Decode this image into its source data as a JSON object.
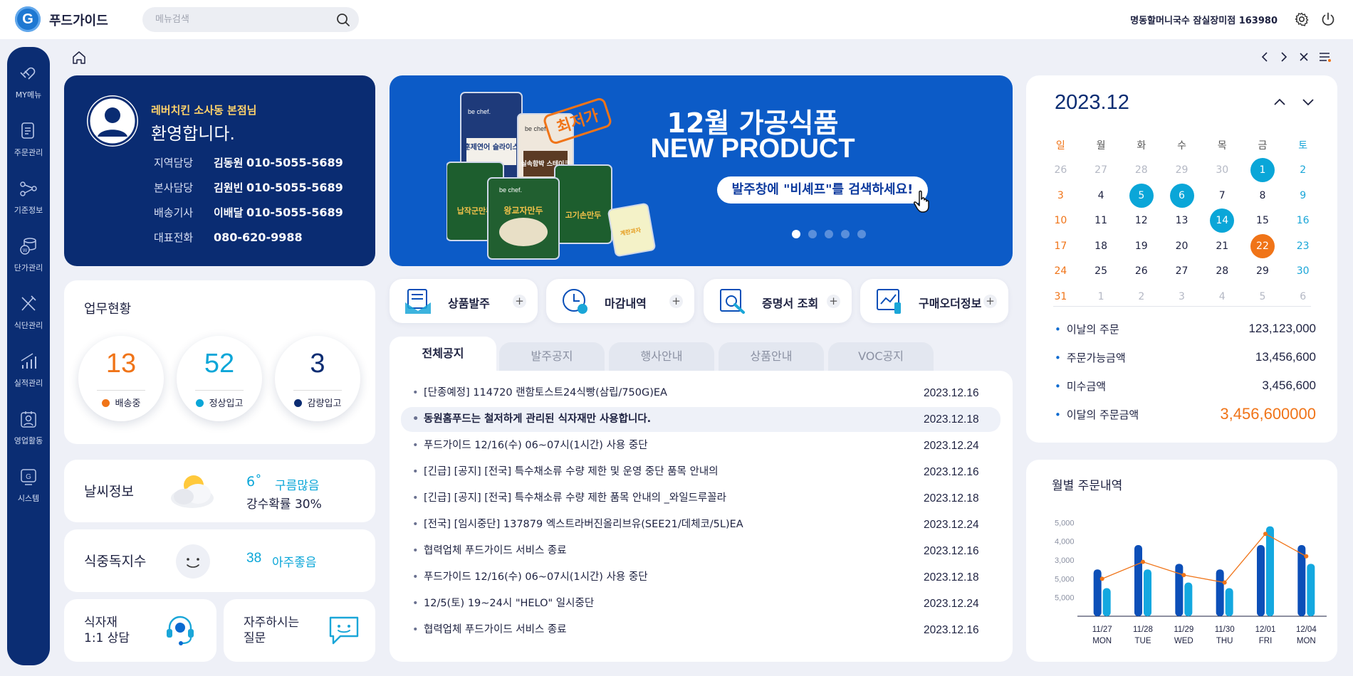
{
  "app": {
    "logo_letter": "G",
    "name": "푸드가이드",
    "search_placeholder": "메뉴검색",
    "store": "명동할머니국수 잠실장미점 163980"
  },
  "sidebar": {
    "items": [
      {
        "label": "MY메뉴",
        "icon": "heart-stack-icon"
      },
      {
        "label": "주문관리",
        "icon": "document-icon"
      },
      {
        "label": "기준정보",
        "icon": "network-icon"
      },
      {
        "label": "단가관리",
        "icon": "coin-stack-icon"
      },
      {
        "label": "식단관리",
        "icon": "cutlery-icon"
      },
      {
        "label": "실적관리",
        "icon": "bar-growth-icon"
      },
      {
        "label": "영업활동",
        "icon": "person-badge-icon"
      },
      {
        "label": "시스템",
        "icon": "g-monitor-icon"
      }
    ]
  },
  "welcome": {
    "name": "레버치킨 소사동 본점님",
    "greeting": "환영합니다.",
    "contacts": [
      {
        "role": "지역담당",
        "name": "김동원",
        "phone": "010-5055-5689"
      },
      {
        "role": "본사담당",
        "name": "김원빈",
        "phone": "010-5055-5689"
      },
      {
        "role": "배송기사",
        "name": "이배달",
        "phone": "010-5055-5689"
      },
      {
        "role": "대표전화",
        "name": "",
        "phone": "080-620-9988"
      }
    ]
  },
  "banner": {
    "title1": "12월 가공식품",
    "title2": "NEW PRODUCT",
    "cta": "발주창에 \"비셰프\"를 검색하세요!",
    "stamp": "최저가",
    "brand": "be chef.",
    "products": [
      "훈제연어 슬라이스",
      "실속함박 스테이크",
      "납작군만두",
      "왕교자만두",
      "고기손만두",
      "계란과자"
    ],
    "slide_count": 5,
    "active_slide": 1
  },
  "status": {
    "title": "업무현황",
    "items": [
      {
        "value": "13",
        "label": "배송중",
        "color": "#f07418"
      },
      {
        "value": "52",
        "label": "정상입고",
        "color": "#0aa6d8"
      },
      {
        "value": "3",
        "label": "감량입고",
        "color": "#0a2c72"
      }
    ]
  },
  "weather": {
    "title": "날씨정보",
    "temp": "6˚",
    "desc": "구름많음",
    "rain": "강수확률 30%"
  },
  "meal_index": {
    "title": "식중독지수",
    "value": "38",
    "desc": "아주좋음"
  },
  "consult": {
    "line1": "식자재",
    "line2": "1:1 상담"
  },
  "faq": {
    "line1": "자주하시는",
    "line2": "질문"
  },
  "quick": [
    {
      "label": "상품발주",
      "icon": "order-envelope-icon"
    },
    {
      "label": "마감내역",
      "icon": "clock-icon"
    },
    {
      "label": "증명서 조회",
      "icon": "magnifier-document-icon"
    },
    {
      "label": "구매오더정보",
      "icon": "chart-board-icon"
    }
  ],
  "notice": {
    "tabs": [
      "전체공지",
      "발주공지",
      "행사안내",
      "상품안내",
      "VOC공지"
    ],
    "active_tab": 0,
    "rows": [
      {
        "title": "[단종예정] 114720 랜함토스트24식빵(삼립/750G)EA",
        "date": "2023.12.16"
      },
      {
        "title": "동원홈푸드는 철저하게 관리된 식자재만 사용합니다.",
        "date": "2023.12.18",
        "highlight": true
      },
      {
        "title": "푸드가이드 12/16(수) 06~07시(1시간) 사용 중단",
        "date": "2023.12.24"
      },
      {
        "title": "[긴급] [공지] [전국] 특수채소류 수량 제한 및 운영 중단 품목 안내의",
        "date": "2023.12.16"
      },
      {
        "title": "[긴급] [공지] [전국] 특수채소류 수량 제한 품목 안내의 _와일드루꼴라",
        "date": "2023.12.18"
      },
      {
        "title": "[전국] [임시중단] 137879 엑스트라버진올리브유(SEE21/데체코/5L)EA",
        "date": "2023.12.24"
      },
      {
        "title": "협력업체 푸드가이드 서비스 종료",
        "date": "2023.12.16"
      },
      {
        "title": "푸드가이드 12/16(수) 06~07시(1시간) 사용 중단",
        "date": "2023.12.18"
      },
      {
        "title": "12/5(토) 19~24시 \"HELO\" 일시중단",
        "date": "2023.12.24"
      },
      {
        "title": "협력업체 푸드가이드 서비스 종료",
        "date": "2023.12.16"
      }
    ]
  },
  "calendar": {
    "title": "2023.12",
    "weekdays": [
      "일",
      "월",
      "화",
      "수",
      "목",
      "금",
      "토"
    ],
    "weeks": [
      [
        {
          "d": "26",
          "o": 1
        },
        {
          "d": "27",
          "o": 1
        },
        {
          "d": "28",
          "o": 1
        },
        {
          "d": "29",
          "o": 1
        },
        {
          "d": "30",
          "o": 1
        },
        {
          "d": "1",
          "m": 1
        },
        {
          "d": "2"
        }
      ],
      [
        {
          "d": "3"
        },
        {
          "d": "4"
        },
        {
          "d": "5",
          "m": 1
        },
        {
          "d": "6",
          "m": 1
        },
        {
          "d": "7"
        },
        {
          "d": "8"
        },
        {
          "d": "9"
        }
      ],
      [
        {
          "d": "10"
        },
        {
          "d": "11"
        },
        {
          "d": "12"
        },
        {
          "d": "13"
        },
        {
          "d": "14",
          "m": 1
        },
        {
          "d": "15"
        },
        {
          "d": "16"
        }
      ],
      [
        {
          "d": "17"
        },
        {
          "d": "18"
        },
        {
          "d": "19"
        },
        {
          "d": "20"
        },
        {
          "d": "21"
        },
        {
          "d": "22",
          "t": 1
        },
        {
          "d": "23"
        }
      ],
      [
        {
          "d": "24"
        },
        {
          "d": "25"
        },
        {
          "d": "26"
        },
        {
          "d": "27"
        },
        {
          "d": "28"
        },
        {
          "d": "29"
        },
        {
          "d": "30"
        }
      ],
      [
        {
          "d": "31"
        },
        {
          "d": "1",
          "o": 1
        },
        {
          "d": "2",
          "o": 1
        },
        {
          "d": "3",
          "o": 1
        },
        {
          "d": "4",
          "o": 1
        },
        {
          "d": "5",
          "o": 1
        },
        {
          "d": "6",
          "o": 1
        }
      ]
    ],
    "summary": [
      {
        "label": "이날의 주문",
        "value": "123,123,000"
      },
      {
        "label": "주문가능금액",
        "value": "13,456,600"
      },
      {
        "label": "미수금액",
        "value": "3,456,600"
      },
      {
        "label": "이달의 주문금액",
        "value": "3,456,600000",
        "accent": true
      }
    ]
  },
  "chart_data": {
    "type": "bar",
    "title": "월별 주문내역",
    "categories": [
      "11/27",
      "11/28",
      "11/29",
      "11/30",
      "12/01",
      "12/04"
    ],
    "sublabels": [
      "MON",
      "TUE",
      "WED",
      "THU",
      "FRI",
      "MON"
    ],
    "ytick_labels": [
      "5,000",
      "4,000",
      "3,000",
      "5,000",
      "5,000"
    ],
    "ytick_values": [
      5,
      4,
      3,
      2,
      1
    ],
    "ylim": [
      0,
      5
    ],
    "series": [
      {
        "values": [
          2.5,
          3.8,
          2.8,
          2.5,
          3.8,
          3.8
        ],
        "color": "#0c4fb8"
      },
      {
        "values": [
          1.5,
          2.5,
          1.8,
          1.5,
          4.8,
          2.8
        ],
        "color": "#14a8e0"
      },
      {
        "type": "line",
        "values": [
          2.0,
          2.9,
          2.2,
          1.8,
          4.4,
          3.2
        ],
        "color": "#f07418"
      }
    ]
  },
  "colors": {
    "navy": "#0a2c72",
    "accent": "#f07418",
    "cyan": "#0aa6d8",
    "bg": "#eef0f7"
  }
}
